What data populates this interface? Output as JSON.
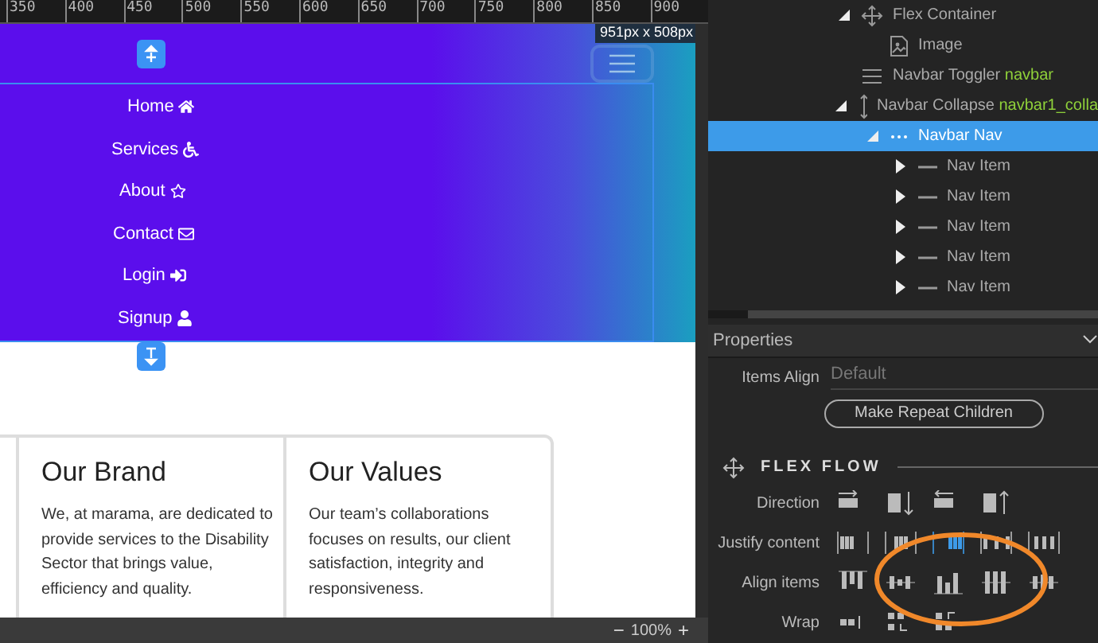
{
  "ruler": {
    "marks": [
      "350",
      "400",
      "450",
      "500",
      "550",
      "600",
      "650",
      "700",
      "750",
      "800",
      "850",
      "900"
    ]
  },
  "canvas": {
    "size_badge": "951px x 508px",
    "nav_items": [
      {
        "label": "Home"
      },
      {
        "label": "Services"
      },
      {
        "label": "About"
      },
      {
        "label": "Contact"
      },
      {
        "label": "Login"
      },
      {
        "label": "Signup"
      }
    ],
    "cards": [
      {
        "title": "Our Brand",
        "text": "We, at marama, are dedicated to provide services to the Disability Sector that brings value, efficiency and quality."
      },
      {
        "title": "Our Values",
        "text": "Our team’s collaborations focuses on results, our client satisfaction, integrity and responsiveness."
      }
    ]
  },
  "zoom": {
    "minus": "−",
    "value": "100%",
    "plus": "+"
  },
  "tree": [
    {
      "label": "Flex Container",
      "kind": "flex",
      "expanded": true,
      "selected": false,
      "children": [
        {
          "label": "Image",
          "kind": "image",
          "selected": false
        }
      ]
    },
    {
      "label": "Navbar Toggler",
      "tag": "navbar",
      "kind": "toggler",
      "selected": false
    },
    {
      "label": "Navbar Collapse",
      "tag": "navbar1_colla",
      "kind": "collapse",
      "expanded": true,
      "selected": false,
      "children": [
        {
          "label": "Navbar Nav",
          "kind": "nav",
          "expanded": true,
          "selected": true,
          "children": [
            {
              "label": "Nav Item",
              "kind": "item",
              "expanded": false,
              "selected": false
            },
            {
              "label": "Nav Item",
              "kind": "item",
              "expanded": false,
              "selected": false
            },
            {
              "label": "Nav Item",
              "kind": "item",
              "expanded": false,
              "selected": false
            },
            {
              "label": "Nav Item",
              "kind": "item",
              "expanded": false,
              "selected": false
            },
            {
              "label": "Nav Item",
              "kind": "item",
              "expanded": false,
              "selected": false
            }
          ]
        }
      ]
    }
  ],
  "properties": {
    "title": "Properties",
    "items_align": {
      "label": "Items Align",
      "value": "Default"
    },
    "repeat_button": "Make Repeat Children",
    "section": "FLEX FLOW",
    "rows": [
      {
        "label": "Direction",
        "kind": "direction",
        "options": [
          {
            "selected": false
          },
          {
            "selected": false
          },
          {
            "selected": false
          },
          {
            "selected": false
          }
        ]
      },
      {
        "label": "Justify content",
        "kind": "justify",
        "options": [
          {
            "selected": false
          },
          {
            "selected": false
          },
          {
            "selected": true
          },
          {
            "selected": false
          },
          {
            "selected": false
          }
        ]
      },
      {
        "label": "Align items",
        "kind": "align",
        "options": [
          {
            "selected": false
          },
          {
            "selected": false
          },
          {
            "selected": false
          },
          {
            "selected": false
          },
          {
            "selected": false
          }
        ]
      },
      {
        "label": "Wrap",
        "kind": "wrap",
        "options": [
          {
            "selected": false
          },
          {
            "selected": false
          },
          {
            "selected": false
          }
        ]
      }
    ]
  }
}
